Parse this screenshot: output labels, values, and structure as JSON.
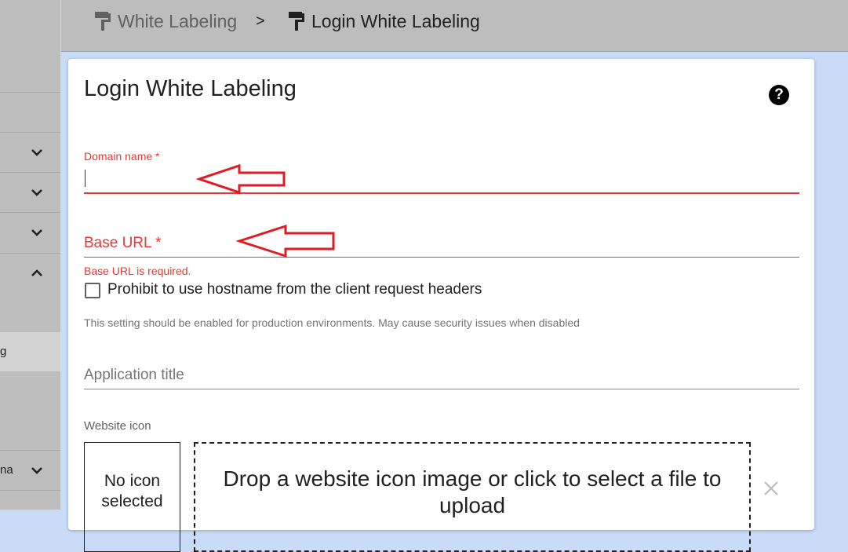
{
  "breadcrumb": {
    "parent": "White Labeling",
    "separator": ">",
    "current": "Login White Labeling"
  },
  "sidebar": {
    "partial_items": [
      "g",
      "na"
    ]
  },
  "card": {
    "title": "Login White Labeling",
    "help_icon": "help-circle-icon"
  },
  "form": {
    "domain_name": {
      "label": "Domain name *",
      "value": ""
    },
    "base_url": {
      "label": "Base URL *",
      "error": "Base URL is required."
    },
    "prohibit_hostname": {
      "label": "Prohibit to use hostname from the client request headers",
      "checked": false,
      "hint": "This setting should be enabled for production environments. May cause security issues when disabled"
    },
    "application_title": {
      "placeholder": "Application title"
    },
    "website_icon": {
      "label": "Website icon",
      "preview_text": "No icon selected",
      "dropzone_text": "Drop a website icon image or click to select a file to upload"
    }
  },
  "colors": {
    "error": "#e53935",
    "annotation_arrow": "#e01b24",
    "toolbar": "#bdbdbd",
    "background": "#c8dcf7"
  }
}
